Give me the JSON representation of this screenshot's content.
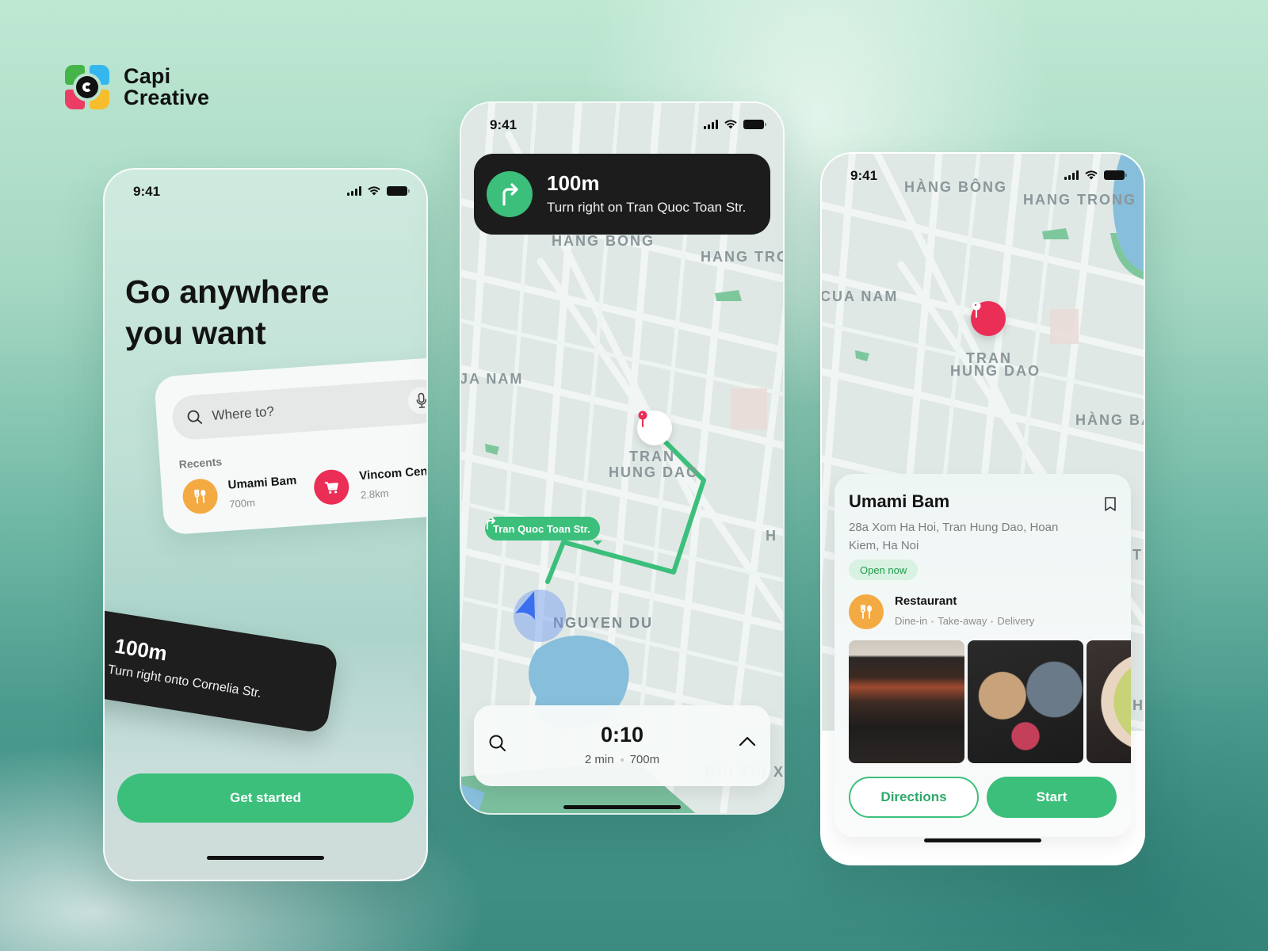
{
  "brand": {
    "name_line1": "Capi",
    "name_line2": "Creative"
  },
  "colors": {
    "accent": "#3bbf7b",
    "dark": "#1c1c1c",
    "pin": "#eb2e55",
    "restaurant": "#f4aa42",
    "user_location": "#3b6ff0"
  },
  "status_bar": {
    "time": "9:41"
  },
  "onboarding": {
    "title_line1": "Go anywhere",
    "title_line2": "you want",
    "search": {
      "placeholder": "Where to?",
      "icon": "search-icon",
      "mic_icon": "microphone-icon"
    },
    "recents_label": "Recents",
    "recents": [
      {
        "name": "Umami Bam",
        "distance": "700m",
        "icon": "restaurant-icon",
        "color": "#f4aa42"
      },
      {
        "name": "Vincom Cent.",
        "distance": "2.8km",
        "icon": "shopping-cart-icon",
        "color": "#eb2e55"
      }
    ],
    "nav_preview": {
      "distance": "100m",
      "instruction": "Turn right onto Cornelia Str."
    },
    "cta_label": "Get started"
  },
  "navigation": {
    "banner": {
      "distance": "100m",
      "instruction": "Turn right on Tran Quoc Toan Str.",
      "icon": "turn-right-icon"
    },
    "map_labels": [
      "HÀNG BÔNG",
      "HANG TRO",
      "JA NAM",
      "TRAN",
      "HUNG DAO",
      "NGUYEN DU",
      "H",
      "BUI THI X"
    ],
    "street_tag": "Tran Quoc Toan Str.",
    "trip": {
      "time": "0:10",
      "duration": "2 min",
      "distance": "700m"
    }
  },
  "place": {
    "map_labels": [
      "HÀNG BÔNG",
      "HANG TRONG",
      "CUA NAM",
      "TRAN",
      "HUNG DAO",
      "HÀNG BÀI",
      "T",
      "H"
    ],
    "name": "Umami Bam",
    "address": "28a Xom Ha Hoi, Tran Hung Dao, Hoan Kiem, Ha Noi",
    "status": "Open now",
    "category": "Restaurant",
    "options": [
      "Dine-in",
      "Take-away",
      "Delivery"
    ],
    "photos": [
      "restaurant interior",
      "ramen and sushi",
      "salmon plate"
    ],
    "directions_label": "Directions",
    "start_label": "Start"
  }
}
